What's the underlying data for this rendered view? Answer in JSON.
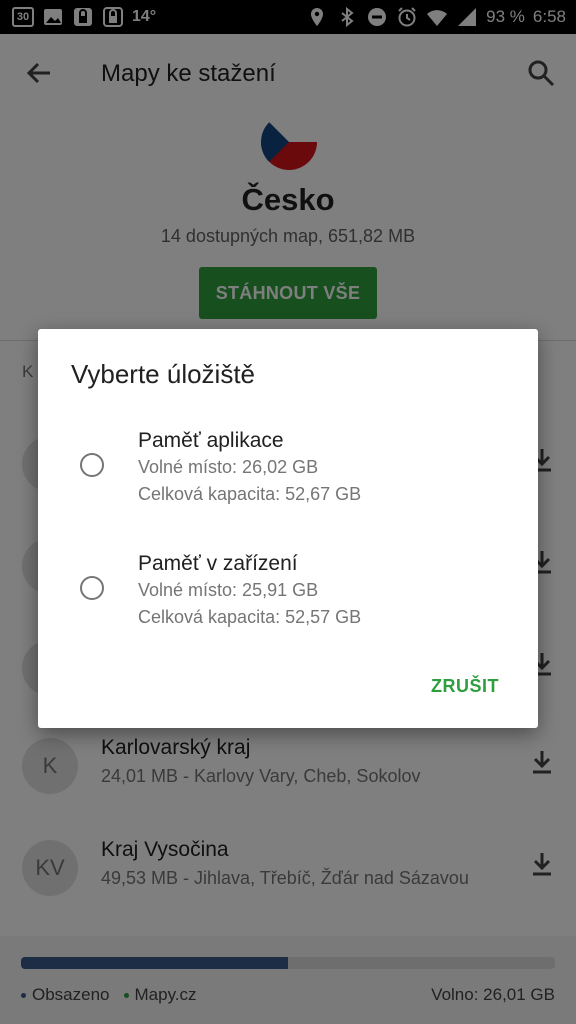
{
  "status_bar": {
    "notif_box": "30",
    "temperature": "14°",
    "battery": "93 %",
    "time": "6:58"
  },
  "app": {
    "title": "Mapy ke stažení",
    "country": "Česko",
    "country_sub": "14 dostupných map, 651,82 MB",
    "download_all": "STÁHNOUT VŠE",
    "section_label": "K",
    "regions": [
      {
        "initials": "K",
        "name": "Karlovarský kraj",
        "detail": "24,01 MB - Karlovy Vary, Cheb, Sokolov"
      },
      {
        "initials": "KV",
        "name": "Kraj Vysočina",
        "detail": "49,53 MB - Jihlava, Třebíč, Žďár nad Sázavou"
      }
    ]
  },
  "storage_bar": {
    "used_fraction": 0.5,
    "legend_used": "Obsazeno",
    "legend_app": "Mapy.cz",
    "free_text": "Volno: 26,01 GB",
    "colors": {
      "used": "#3a5a8c",
      "app": "#2e9e3e"
    }
  },
  "dialog": {
    "title": "Vyberte úložiště",
    "options": [
      {
        "name": "Paměť aplikace",
        "free": "Volné místo: 26,02 GB",
        "capacity": "Celková kapacita: 52,67 GB"
      },
      {
        "name": "Paměť v zařízení",
        "free": "Volné místo: 25,91 GB",
        "capacity": "Celková kapacita: 52,57 GB"
      }
    ],
    "cancel_label": "ZRUŠIT"
  },
  "colors": {
    "accent": "#2e9e3e"
  }
}
